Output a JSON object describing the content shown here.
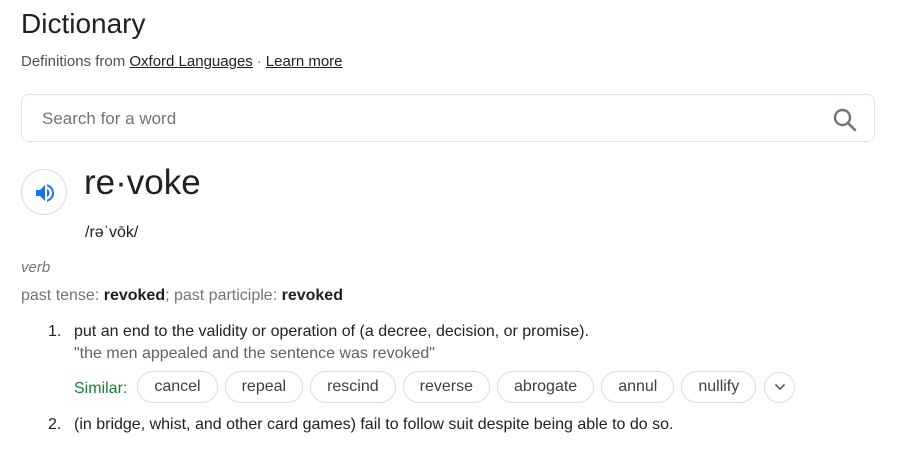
{
  "header": {
    "title": "Dictionary",
    "source_prefix": "Definitions from",
    "source_link": "Oxford Languages",
    "separator": "·",
    "learn_more": "Learn more"
  },
  "search": {
    "placeholder": "Search for a word",
    "value": ""
  },
  "entry": {
    "word": "re·voke",
    "phonetic": "/rəˈvōk/",
    "part_of_speech": "verb",
    "forms": {
      "past_tense_label": "past tense",
      "past_tense": "revoked",
      "past_participle_label": "past participle",
      "past_participle": "revoked"
    },
    "senses": [
      {
        "number": "1.",
        "definition": "put an end to the validity or operation of (a decree, decision, or promise).",
        "example": "\"the men appealed and the sentence was revoked\"",
        "similar_label": "Similar:",
        "similar": [
          "cancel",
          "repeal",
          "rescind",
          "reverse",
          "abrogate",
          "annul",
          "nullify"
        ]
      },
      {
        "number": "2.",
        "definition": "(in bridge, whist, and other card games) fail to follow suit despite being able to do so."
      }
    ]
  },
  "icons": {
    "search": "search-icon",
    "speaker": "speaker-icon",
    "expand": "chevron-down-icon"
  },
  "colors": {
    "accent_blue": "#1a73e8",
    "similar_green": "#188038",
    "muted": "#70757a"
  }
}
